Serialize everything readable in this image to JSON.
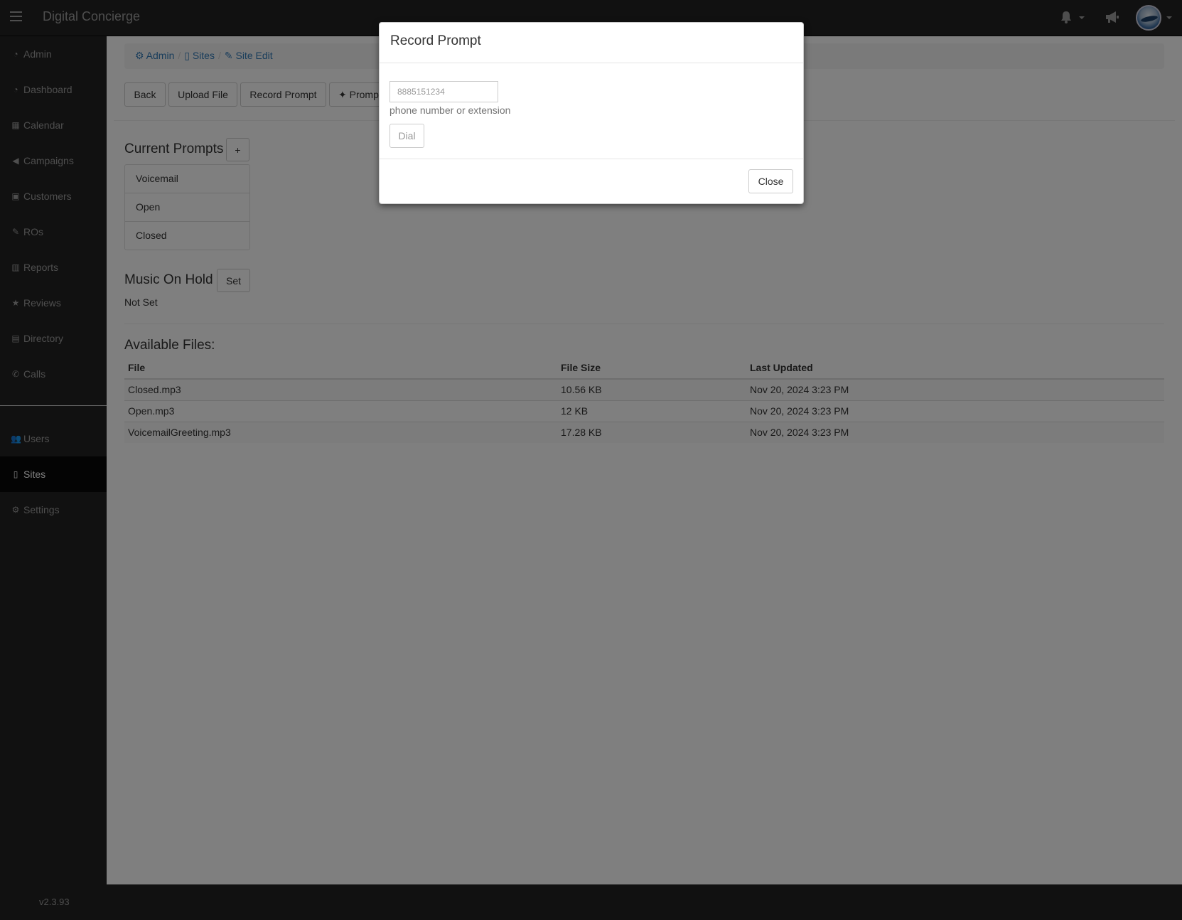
{
  "app": {
    "brand": "Digital Concierge",
    "version": "v2.3.93"
  },
  "navbar": {
    "icons": [
      "menu-icon",
      "bell-icon",
      "bullhorn-icon",
      "avatar"
    ]
  },
  "sidebar": {
    "items": [
      {
        "icon": "dashboard-icon",
        "label": "Admin"
      },
      {
        "icon": "dashboard-icon",
        "label": "Dashboard"
      },
      {
        "icon": "calendar-icon",
        "label": "Calendar"
      },
      {
        "icon": "bullhorn-icon",
        "label": "Campaigns"
      },
      {
        "icon": "address-book-icon",
        "label": "Customers"
      },
      {
        "icon": "wrench-icon",
        "label": "ROs"
      },
      {
        "icon": "bar-chart-icon",
        "label": "Reports"
      },
      {
        "icon": "star-icon",
        "label": "Reviews"
      },
      {
        "icon": "book-icon",
        "label": "Directory"
      },
      {
        "icon": "phone-icon",
        "label": "Calls"
      },
      {
        "icon": "users-icon",
        "label": "Users"
      },
      {
        "icon": "building-icon",
        "label": "Sites",
        "active": true
      },
      {
        "icon": "gear-icon",
        "label": "Settings"
      }
    ]
  },
  "breadcrumb": [
    {
      "icon": "gear-icon",
      "label": "Admin"
    },
    {
      "icon": "building-icon",
      "label": "Sites"
    },
    {
      "icon": "edit-icon",
      "label": "Site Edit"
    }
  ],
  "toolbar": {
    "back": "Back",
    "upload": "Upload File",
    "record": "Record Prompt",
    "prompt_partial": "Promp"
  },
  "current_prompts": {
    "heading": "Current Prompts",
    "add_label": "+",
    "items": [
      "Voicemail",
      "Open",
      "Closed"
    ]
  },
  "music_on_hold": {
    "heading": "Music On Hold",
    "set_label": "Set",
    "status": "Not Set"
  },
  "files": {
    "heading": "Available Files:",
    "columns": [
      "File",
      "File Size",
      "Last Updated"
    ],
    "rows": [
      [
        "Closed.mp3",
        "10.56 KB",
        "Nov 20, 2024 3:23 PM"
      ],
      [
        "Open.mp3",
        "12 KB",
        "Nov 20, 2024 3:23 PM"
      ],
      [
        "VoicemailGreeting.mp3",
        "17.28 KB",
        "Nov 20, 2024 3:23 PM"
      ]
    ]
  },
  "modal": {
    "title": "Record Prompt",
    "phone_placeholder": "8885151234",
    "help": "phone number or extension",
    "dial_label": "Dial",
    "close_label": "Close"
  },
  "colors": {
    "navbar": "#222222",
    "link": "#337ab7",
    "active_item": "#080808"
  }
}
